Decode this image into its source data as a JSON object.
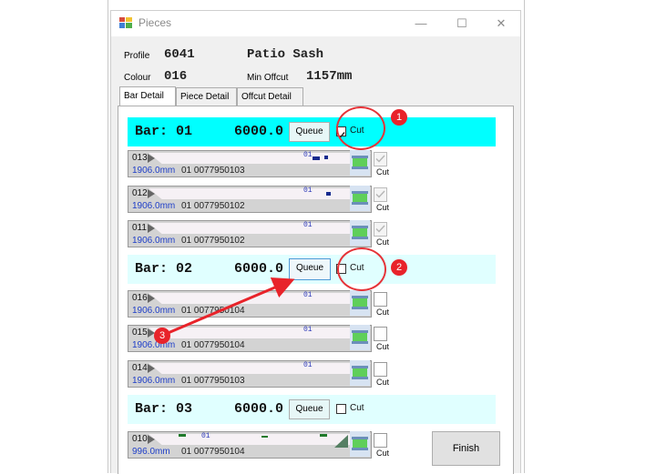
{
  "window": {
    "title": "Pieces",
    "minimize": "—",
    "maximize": "☐",
    "close": "✕"
  },
  "header": {
    "profile_label": "Profile",
    "profile_value": "6041",
    "profile_name": "Patio Sash",
    "colour_label": "Colour",
    "colour_value": "016",
    "min_offcut_label": "Min Offcut",
    "min_offcut_value": "1157mm"
  },
  "tabs": [
    "Bar Detail",
    "Piece Detail",
    "Offcut Detail"
  ],
  "active_tab": "Bar Detail",
  "bars": [
    {
      "title": "Bar: 01",
      "length": "6000.0",
      "queue_label": "Queue",
      "cut_label": "Cut",
      "cut_checked": true,
      "highlighted": true
    },
    {
      "title": "Bar: 02",
      "length": "6000.0",
      "queue_label": "Queue",
      "cut_label": "Cut",
      "cut_checked": false,
      "highlighted": false
    },
    {
      "title": "Bar: 03",
      "length": "6000.0",
      "queue_label": "Queue",
      "cut_label": "Cut",
      "cut_checked": false,
      "highlighted": false
    }
  ],
  "pieces": [
    {
      "id": "013",
      "length": "1906.0mm",
      "code": "01 0077950103",
      "num": "01",
      "cut_label": "Cut",
      "cut_checked": true,
      "disabled": true
    },
    {
      "id": "012",
      "length": "1906.0mm",
      "code": "01 0077950102",
      "num": "01",
      "cut_label": "Cut",
      "cut_checked": true,
      "disabled": true
    },
    {
      "id": "011",
      "length": "1906.0mm",
      "code": "01 0077950102",
      "num": "01",
      "cut_label": "Cut",
      "cut_checked": true,
      "disabled": true
    },
    {
      "id": "016",
      "length": "1906.0mm",
      "code": "01 0077950104",
      "num": "01",
      "cut_label": "Cut",
      "cut_checked": false,
      "disabled": false
    },
    {
      "id": "015",
      "length": "1906.0mm",
      "code": "01 0077950104",
      "num": "01",
      "cut_label": "Cut",
      "cut_checked": false,
      "disabled": false
    },
    {
      "id": "014",
      "length": "1906.0mm",
      "code": "01 0077950103",
      "num": "01",
      "cut_label": "Cut",
      "cut_checked": false,
      "disabled": false
    },
    {
      "id": "010",
      "length": "996.0mm",
      "code": "01 0077950104",
      "num": "01",
      "cut_label": "Cut",
      "cut_checked": false,
      "disabled": false
    }
  ],
  "finish_label": "Finish",
  "callouts": [
    "1",
    "2",
    "3"
  ],
  "colors": {
    "active_bar": "#00ffff",
    "bar": "#e0ffff",
    "annotation": "#e8232a",
    "piece_length": "#1e3ec8"
  }
}
